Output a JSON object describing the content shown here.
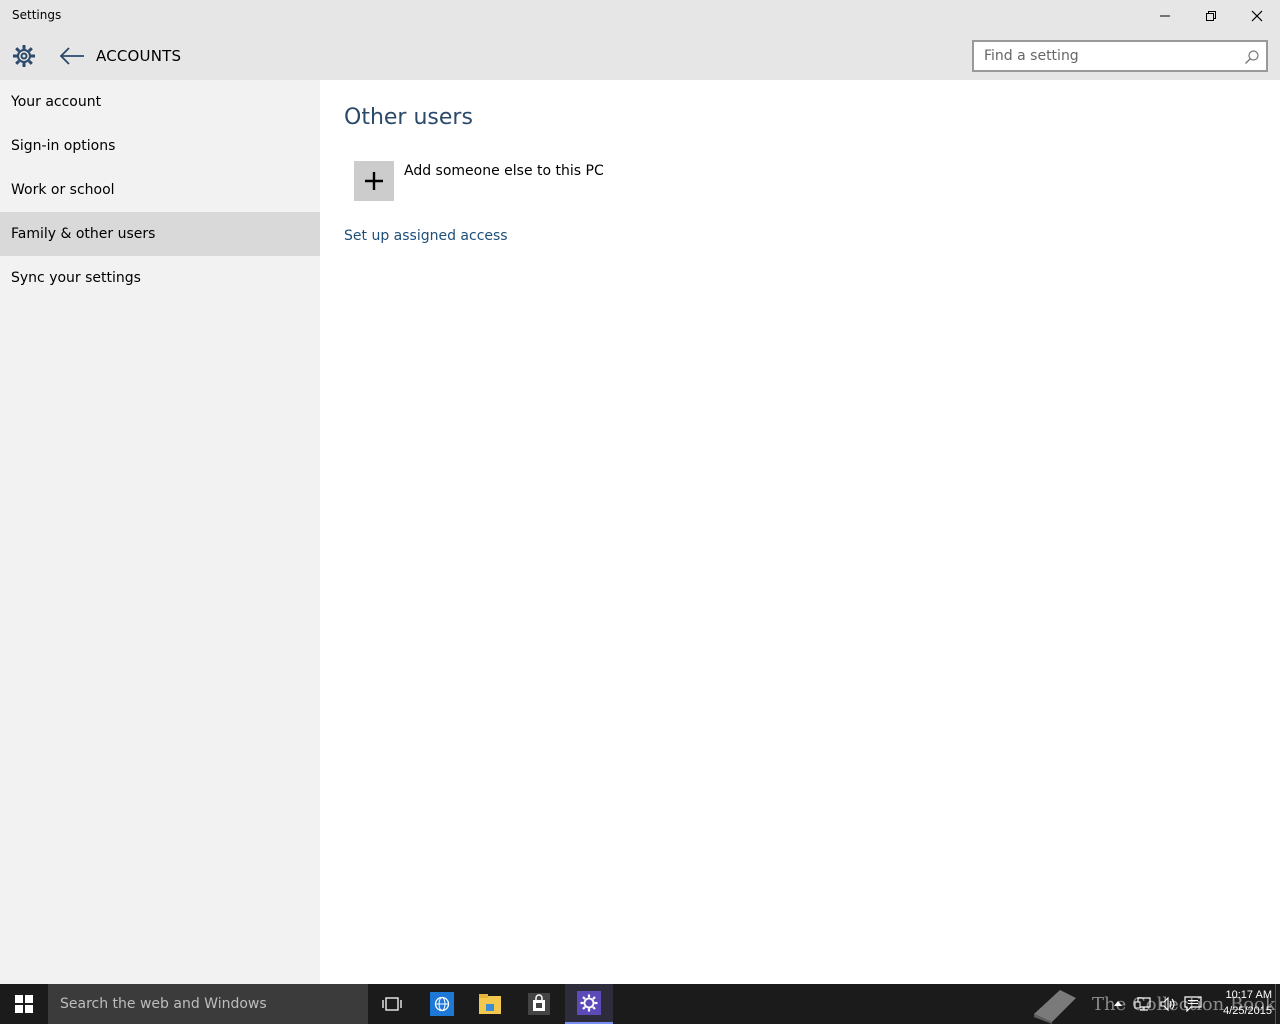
{
  "window": {
    "title": "Settings"
  },
  "header": {
    "page_title": "ACCOUNTS",
    "search_placeholder": "Find a setting"
  },
  "sidebar": {
    "items": [
      {
        "label": "Your account",
        "selected": false
      },
      {
        "label": "Sign-in options",
        "selected": false
      },
      {
        "label": "Work or school",
        "selected": false
      },
      {
        "label": "Family & other users",
        "selected": true
      },
      {
        "label": "Sync your settings",
        "selected": false
      }
    ]
  },
  "main": {
    "section_title": "Other users",
    "add_label": "Add someone else to this PC",
    "assigned_access_link": "Set up assigned access"
  },
  "taskbar": {
    "search_placeholder": "Search the web and Windows",
    "time": "10:17 AM",
    "date": "4/25/2015",
    "watermark": "The Collection Book"
  },
  "colors": {
    "accent_title": "#2b4a6b",
    "link": "#1e4e79",
    "selected_nav": "#d9d9d9",
    "sidebar_bg": "#f2f2f2",
    "titlebar_bg": "#e6e6e6",
    "taskbar_bg": "#1b1b1b"
  }
}
